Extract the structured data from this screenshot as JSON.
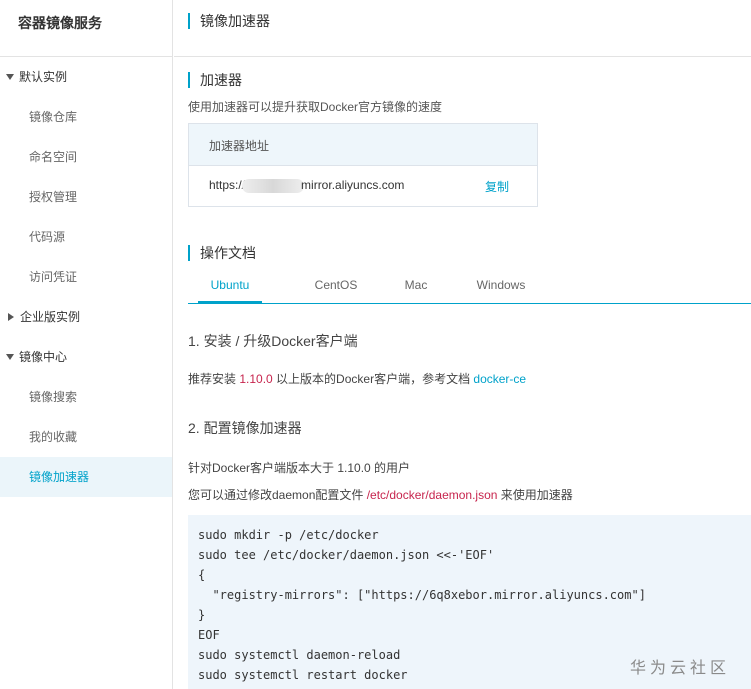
{
  "sidebar": {
    "title": "容器镜像服务",
    "groups": [
      {
        "label": "默认实例",
        "expanded": true,
        "items": [
          "镜像仓库",
          "命名空间",
          "授权管理",
          "代码源",
          "访问凭证"
        ]
      },
      {
        "label": "企业版实例",
        "expanded": false,
        "items": []
      },
      {
        "label": "镜像中心",
        "expanded": true,
        "items": [
          "镜像搜索",
          "我的收藏",
          "镜像加速器"
        ],
        "active": "镜像加速器"
      }
    ]
  },
  "page": {
    "title": "镜像加速器"
  },
  "accelerator": {
    "section_title": "加速器",
    "description": "使用加速器可以提升获取Docker官方镜像的速度",
    "box_header": "加速器地址",
    "address_prefix": "https://",
    "address_suffix": "mirror.aliyuncs.com",
    "copy_label": "复制"
  },
  "docs": {
    "section_title": "操作文档",
    "tabs": [
      "Ubuntu",
      "CentOS",
      "Mac",
      "Windows"
    ],
    "active_tab": "Ubuntu",
    "step1_title": "1. 安装 / 升级Docker客户端",
    "step1_text_a": "推荐安装 ",
    "step1_version": "1.10.0",
    "step1_text_b": " 以上版本的Docker客户端，参考文档 ",
    "step1_link": "docker-ce",
    "step2_title": "2. 配置镜像加速器",
    "step2_text1": "针对Docker客户端版本大于 1.10.0 的用户",
    "step2_text2_a": "您可以通过修改daemon配置文件 ",
    "step2_path": "/etc/docker/daemon.json",
    "step2_text2_b": " 来使用加速器",
    "code_lines": [
      "sudo mkdir -p /etc/docker",
      "sudo tee /etc/docker/daemon.json <<-'EOF'",
      "{",
      "  \"registry-mirrors\": [\"https://6q8xebor.mirror.aliyuncs.com\"]",
      "}",
      "EOF",
      "sudo systemctl daemon-reload",
      "sudo systemctl restart docker"
    ]
  },
  "watermark": "华为云社区",
  "colors": {
    "accent": "#00a2ca",
    "highlight": "#c7254e"
  }
}
